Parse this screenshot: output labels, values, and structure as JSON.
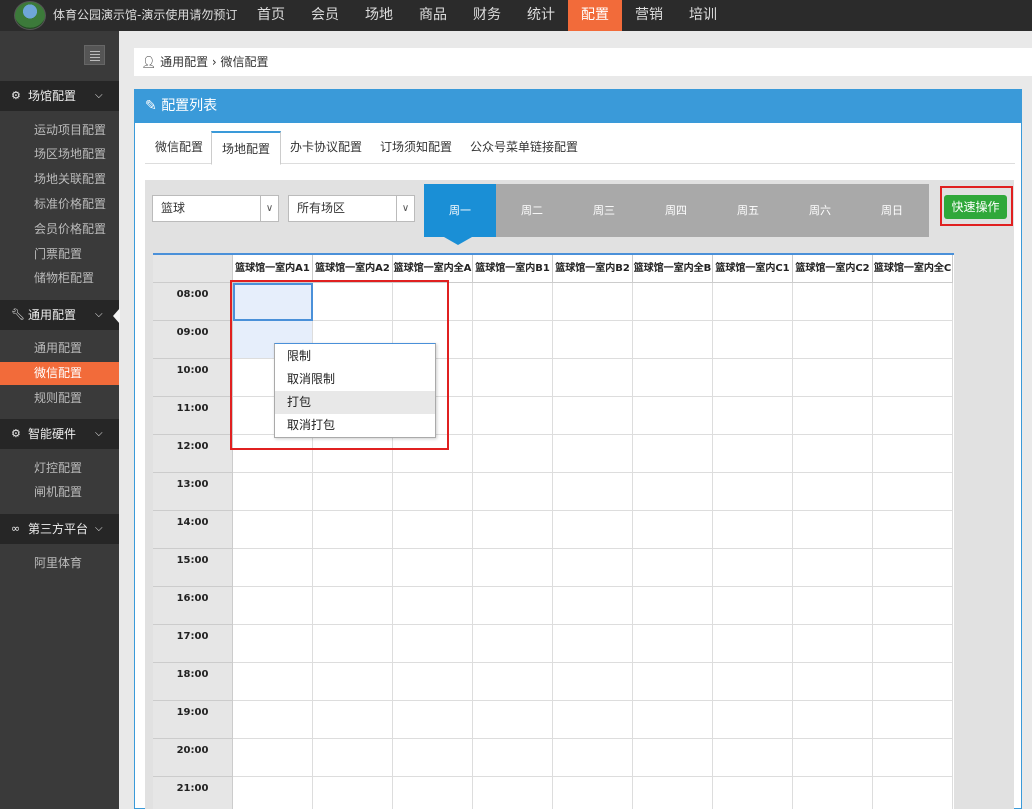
{
  "header": {
    "app_title": "体育公园演示馆-演示使用请勿预订",
    "nav": [
      "首页",
      "会员",
      "场地",
      "商品",
      "财务",
      "统计",
      "配置",
      "营销",
      "培训"
    ],
    "active_nav": "配置"
  },
  "sidebar": {
    "groups": [
      {
        "label": "场馆配置",
        "icon": "gears-icon",
        "items": [
          "运动项目配置",
          "场区场地配置",
          "场地关联配置",
          "标准价格配置",
          "会员价格配置",
          "门票配置",
          "储物柜配置"
        ]
      },
      {
        "label": "通用配置",
        "icon": "wrench-icon",
        "items": [
          "通用配置",
          "微信配置",
          "规则配置"
        ]
      },
      {
        "label": "智能硬件",
        "icon": "gear-icon",
        "items": [
          "灯控配置",
          "闸机配置"
        ]
      },
      {
        "label": "第三方平台",
        "icon": "handshake-icon",
        "items": [
          "阿里体育"
        ]
      }
    ],
    "active_item": "微信配置"
  },
  "breadcrumb": {
    "root": "通用配置",
    "sep": "›",
    "current": "微信配置"
  },
  "panel": {
    "title": "配置列表",
    "tabs": [
      "微信配置",
      "场地配置",
      "办卡协议配置",
      "订场须知配置",
      "公众号菜单链接配置"
    ],
    "active_tab": "场地配置"
  },
  "filters": {
    "sport": "篮球",
    "area": "所有场区"
  },
  "days": [
    "周一",
    "周二",
    "周三",
    "周四",
    "周五",
    "周六",
    "周日"
  ],
  "active_day": "周一",
  "quick_action": "快速操作",
  "schedule": {
    "columns": [
      "篮球馆一室内A1",
      "篮球馆一室内A2",
      "篮球馆一室内全A",
      "篮球馆一室内B1",
      "篮球馆一室内B2",
      "篮球馆一室内全B",
      "篮球馆一室内C1",
      "篮球馆一室内C2",
      "篮球馆一室内全C"
    ],
    "times": [
      "08:00",
      "09:00",
      "10:00",
      "11:00",
      "12:00",
      "13:00",
      "14:00",
      "15:00",
      "16:00",
      "17:00",
      "18:00",
      "19:00",
      "20:00",
      "21:00"
    ]
  },
  "context_menu": {
    "items": [
      "限制",
      "取消限制",
      "打包",
      "取消打包"
    ],
    "hovered": "打包"
  },
  "colors": {
    "accent": "#f26b3a",
    "panel_blue": "#3a9ad9",
    "day_active": "#1a8fd6",
    "quick_green": "#2fa83a",
    "highlight_red": "#e02020"
  }
}
